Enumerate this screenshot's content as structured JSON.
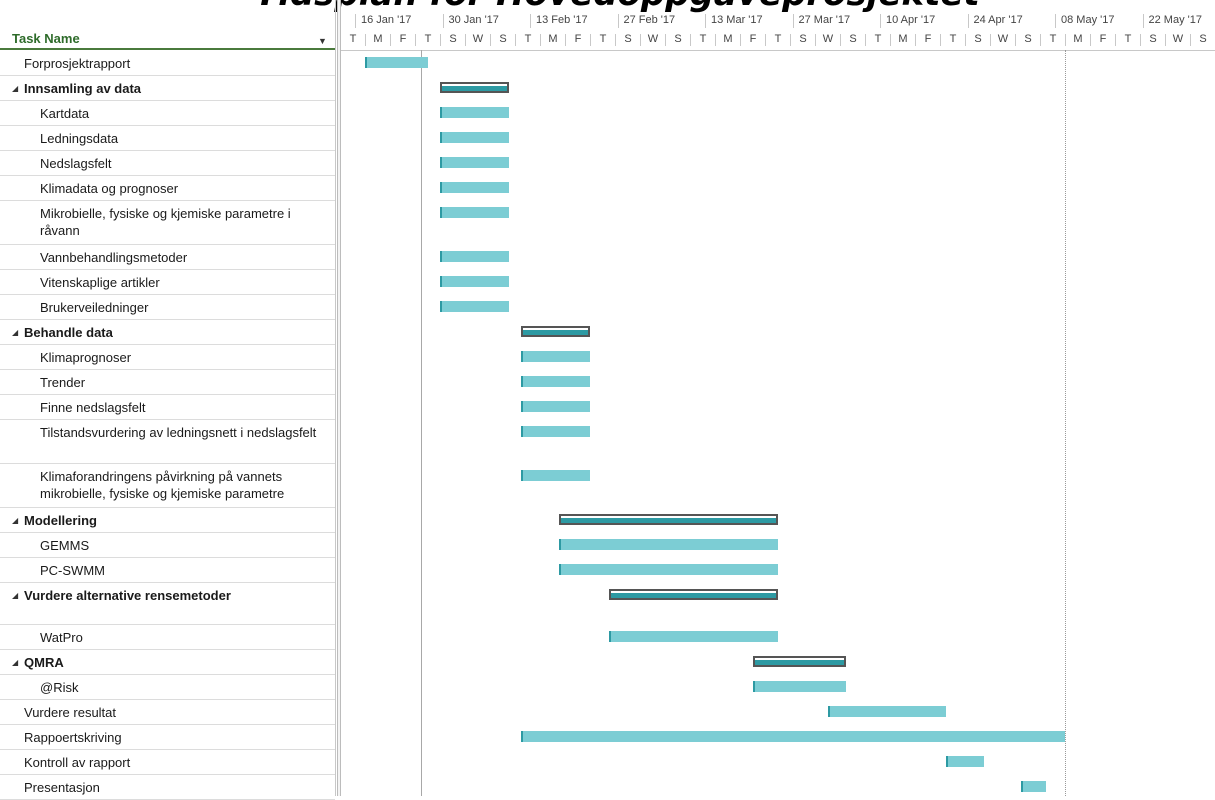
{
  "title": "Tidsplan for Hovedoppgaveprosjektet",
  "grid_header": {
    "task_name": "Task Name"
  },
  "weeks": [
    "16 Jan '17",
    "30 Jan '17",
    "13 Feb '17",
    "27 Feb '17",
    "13 Mar '17",
    "27 Mar '17",
    "10 Apr '17",
    "24 Apr '17",
    "08 May '17",
    "22 May '17"
  ],
  "day_labels": [
    "T",
    "M",
    "F",
    "T",
    "S",
    "W",
    "S",
    "T",
    "M",
    "F",
    "T",
    "S",
    "W",
    "S",
    "T",
    "M",
    "F",
    "T",
    "S",
    "W",
    "S",
    "T",
    "M",
    "F",
    "T",
    "S",
    "W",
    "S",
    "T",
    "M",
    "F",
    "T",
    "S",
    "W",
    "S"
  ],
  "tasks": [
    {
      "name": "Forprosjektrapport",
      "level": 0,
      "summary": false
    },
    {
      "name": "Innsamling av data",
      "level": 0,
      "summary": true
    },
    {
      "name": "Kartdata",
      "level": 1,
      "summary": false
    },
    {
      "name": "Ledningsdata",
      "level": 1,
      "summary": false
    },
    {
      "name": "Nedslagsfelt",
      "level": 1,
      "summary": false
    },
    {
      "name": "Klimadata og prognoser",
      "level": 1,
      "summary": false
    },
    {
      "name": "Mikrobielle, fysiske og kjemiske parametre i råvann",
      "level": 1,
      "summary": false
    },
    {
      "name": "Vannbehandlingsmetoder",
      "level": 1,
      "summary": false
    },
    {
      "name": "Vitenskaplige artikler",
      "level": 1,
      "summary": false
    },
    {
      "name": "Brukerveiledninger",
      "level": 1,
      "summary": false
    },
    {
      "name": "Behandle data",
      "level": 0,
      "summary": true
    },
    {
      "name": "Klimaprognoser",
      "level": 1,
      "summary": false
    },
    {
      "name": "Trender",
      "level": 1,
      "summary": false
    },
    {
      "name": "Finne nedslagsfelt",
      "level": 1,
      "summary": false
    },
    {
      "name": "Tilstandsvurdering av ledningsnett i nedslagsfelt",
      "level": 1,
      "summary": false
    },
    {
      "name": "Klimaforandringens påvirkning på vannets mikrobielle, fysiske og kjemiske parametre",
      "level": 1,
      "summary": false
    },
    {
      "name": "Modellering",
      "level": 0,
      "summary": true
    },
    {
      "name": "GEMMS",
      "level": 1,
      "summary": false
    },
    {
      "name": "PC-SWMM",
      "level": 1,
      "summary": false
    },
    {
      "name": "Vurdere alternative rensemetoder",
      "level": 0,
      "summary": true
    },
    {
      "name": "WatPro",
      "level": 1,
      "summary": false
    },
    {
      "name": "QMRA",
      "level": 0,
      "summary": true
    },
    {
      "name": "@Risk",
      "level": 1,
      "summary": false
    },
    {
      "name": "Vurdere resultat",
      "level": 0,
      "summary": false
    },
    {
      "name": "Rappoertskriving",
      "level": 0,
      "summary": false
    },
    {
      "name": "Kontroll av rapport",
      "level": 0,
      "summary": false
    },
    {
      "name": "Presentasjon",
      "level": 0,
      "summary": false
    }
  ],
  "schedule": [
    {
      "start": "2017-01-16",
      "finish": "2017-01-26"
    },
    {
      "start": "2017-01-28",
      "finish": "2017-02-08"
    },
    {
      "start": "2017-01-28",
      "finish": "2017-02-08"
    },
    {
      "start": "2017-01-28",
      "finish": "2017-02-08"
    },
    {
      "start": "2017-01-28",
      "finish": "2017-02-08"
    },
    {
      "start": "2017-01-28",
      "finish": "2017-02-08"
    },
    {
      "start": "2017-01-28",
      "finish": "2017-02-08"
    },
    {
      "start": "2017-01-28",
      "finish": "2017-02-08"
    },
    {
      "start": "2017-01-28",
      "finish": "2017-02-08"
    },
    {
      "start": "2017-01-28",
      "finish": "2017-02-08"
    },
    {
      "start": "2017-02-10",
      "finish": "2017-02-21"
    },
    {
      "start": "2017-02-10",
      "finish": "2017-02-21"
    },
    {
      "start": "2017-02-10",
      "finish": "2017-02-21"
    },
    {
      "start": "2017-02-10",
      "finish": "2017-02-21"
    },
    {
      "start": "2017-02-10",
      "finish": "2017-02-21"
    },
    {
      "start": "2017-02-10",
      "finish": "2017-02-21"
    },
    {
      "start": "2017-02-16",
      "finish": "2017-03-23"
    },
    {
      "start": "2017-02-16",
      "finish": "2017-03-23"
    },
    {
      "start": "2017-02-16",
      "finish": "2017-03-23"
    },
    {
      "start": "2017-02-24",
      "finish": "2017-03-23"
    },
    {
      "start": "2017-02-24",
      "finish": "2017-03-23"
    },
    {
      "start": "2017-03-19",
      "finish": "2017-04-03"
    },
    {
      "start": "2017-03-19",
      "finish": "2017-04-03"
    },
    {
      "start": "2017-03-31",
      "finish": "2017-04-19"
    },
    {
      "start": "2017-02-10",
      "finish": "2017-05-08"
    },
    {
      "start": "2017-04-19",
      "finish": "2017-04-25"
    },
    {
      "start": "2017-05-01",
      "finish": "2017-05-05"
    }
  ],
  "markers": [
    {
      "date": "2017-01-25",
      "color": "#a8a8a8"
    },
    {
      "date": "2017-05-08",
      "color": "#9a9a9a"
    }
  ],
  "colors": {
    "bar_fill": "#7ccdd4",
    "bar_edge": "#2d9aa3",
    "summary_border": "#555555",
    "header_text": "#2e6b2a"
  }
}
